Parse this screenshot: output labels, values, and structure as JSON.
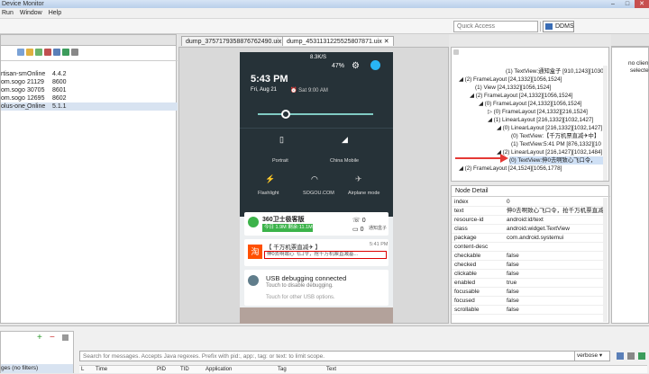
{
  "window": {
    "title": "Device Monitor"
  },
  "menu": [
    "Run",
    "Window",
    "Help"
  ],
  "toolbar": {
    "quick_access_placeholder": "Quick Access",
    "ddms_label": "DDMS"
  },
  "devices": [
    {
      "name": "rtisan-sm",
      "status": "Online",
      "port": "4.4.2"
    },
    {
      "name": "om.sogo",
      "status": "21129",
      "port": "8600"
    },
    {
      "name": "om.sogo",
      "status": "30705",
      "port": "8601"
    },
    {
      "name": "om.sogo",
      "status": "12695",
      "port": "8602"
    },
    {
      "name": "olus-one_",
      "status": "Online",
      "port": "5.1.1"
    }
  ],
  "editor_tabs": [
    "dump_3757179358876762490.uix",
    "dump_4531131225525807871.uix"
  ],
  "phone": {
    "status": {
      "network": "8.3K/S",
      "battery": "47%"
    },
    "time": "5:43 PM",
    "date": "Fri, Aug 21",
    "alarm": "Sat 9:00 AM",
    "toggles": [
      {
        "label": "Portrait"
      },
      {
        "label": "China Mobile"
      }
    ],
    "toggles2": [
      {
        "label": "Flashlight"
      },
      {
        "label": "SOGOU.COM"
      },
      {
        "label": "Airplane mode"
      }
    ],
    "notif1": {
      "title": "360卫士极客版",
      "today": "今日 1.9M",
      "remain": "剩余:11.1M",
      "count1": "0",
      "count2": "0",
      "extra": "通知盒子"
    },
    "notif2": {
      "title": "【 千万机票直减✈ 】",
      "time": "5:41 PM",
      "text": "伸0去啊致心飞口令，抢千万机票直减基...",
      "icon_text": "淘"
    },
    "notif3": {
      "title": "USB debugging connected",
      "sub": "Touch to disable debugging.",
      "sub2": "Touch for other USB options."
    }
  },
  "tree_lines": [
    "(1) TextView:通知盒子 [910,1243][1030,",
    "(2) FrameLayout [24,1332][1056,1524]",
    "(1) View [24,1332][1056,1524]",
    "(2) FrameLayout [24,1332][1056,1524]",
    "(0) FrameLayout [24,1332][1056,1524]",
    "(0) FrameLayout [24,1332][216,1524]",
    "(1) LinearLayout [216,1332][1032,1427]",
    "(0) LinearLayout [216,1332][1032,1427]",
    "(0) TextView:【千万机票直减✈中】",
    "(1) TextView:5:41 PM [876,1332][10",
    "(2) LinearLayout [216,1427][1032,1484]",
    "(0) TextView:伸0去啊致心飞口令，",
    "(2) FrameLayout [24,1524][1056,1778]"
  ],
  "node_detail": {
    "title": "Node Detail",
    "rows": [
      {
        "k": "index",
        "v": "0"
      },
      {
        "k": "text",
        "v": "伸0去啊致心飞口令，抢千万机票直减"
      },
      {
        "k": "resource-id",
        "v": "android:id/text"
      },
      {
        "k": "class",
        "v": "android.widget.TextView"
      },
      {
        "k": "package",
        "v": "com.android.systemui"
      },
      {
        "k": "content-desc",
        "v": ""
      },
      {
        "k": "checkable",
        "v": "false"
      },
      {
        "k": "checked",
        "v": "false"
      },
      {
        "k": "clickable",
        "v": "false"
      },
      {
        "k": "enabled",
        "v": "true"
      },
      {
        "k": "focusable",
        "v": "false"
      },
      {
        "k": "focused",
        "v": "false"
      },
      {
        "k": "scrollable",
        "v": "false"
      }
    ]
  },
  "right_panel": {
    "line1": "no clien",
    "line2": "selecte"
  },
  "logcat": {
    "search_placeholder": "Search for messages. Accepts Java regexes. Prefix with pid:, app:, tag: or text: to limit scope.",
    "level": "verbose",
    "filter": "ges (no filters)",
    "columns": [
      "L",
      "Time",
      "PID",
      "TID",
      "Application",
      "Tag",
      "Text"
    ]
  }
}
